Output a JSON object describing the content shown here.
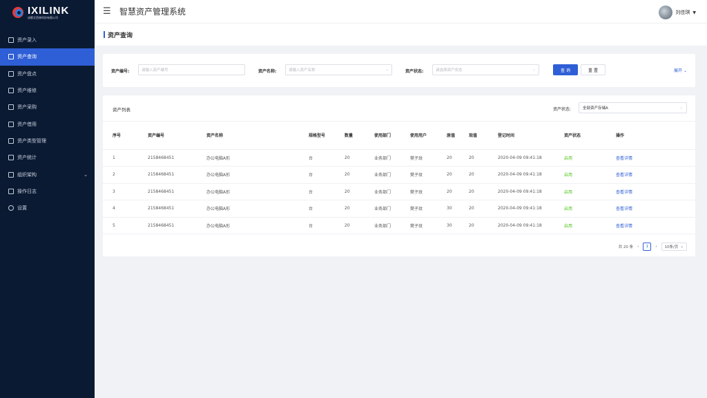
{
  "logo": {
    "name": "IXILINK",
    "subtitle": "成都艾西林科技有限公司"
  },
  "header": {
    "title": "智慧资产管理系统",
    "user_name": "刘佳琪",
    "menu_icon": "hamburger-icon"
  },
  "sidebar": {
    "items": [
      {
        "label": "资产录入",
        "icon": "edit-icon",
        "active": false
      },
      {
        "label": "资产查询",
        "icon": "search-doc-icon",
        "active": true
      },
      {
        "label": "资产盘点",
        "icon": "clipboard-icon",
        "active": false
      },
      {
        "label": "资产维修",
        "icon": "wrench-icon",
        "active": false
      },
      {
        "label": "资产采购",
        "icon": "cart-icon",
        "active": false
      },
      {
        "label": "资产借用",
        "icon": "borrow-icon",
        "active": false
      },
      {
        "label": "资产类型管理",
        "icon": "category-icon",
        "active": false
      },
      {
        "label": "资产统计",
        "icon": "chart-icon",
        "active": false
      },
      {
        "label": "组织架构",
        "icon": "org-icon",
        "active": false,
        "expandable": true
      },
      {
        "label": "操作日志",
        "icon": "log-icon",
        "active": false
      },
      {
        "label": "设置",
        "icon": "gear-icon",
        "active": false
      }
    ]
  },
  "page": {
    "title": "资产查询"
  },
  "search": {
    "asset_no_label": "资产编号:",
    "asset_no_placeholder": "请输入资产编号",
    "asset_name_label": "资产名称:",
    "asset_name_placeholder": "请输入资产名称",
    "asset_status_label": "资产状态:",
    "asset_status_placeholder": "请选择资产状态",
    "query_button": "查 询",
    "reset_button": "重 置",
    "expand_label": "展开"
  },
  "list": {
    "title": "资产列表",
    "filter_label": "资产状态:",
    "filter_value": "全部资产存储A",
    "columns": [
      "序号",
      "资产编号",
      "资产名称",
      "规格型号",
      "数量",
      "使用部门",
      "使用用户",
      "原值",
      "现值",
      "登记时间",
      "资产状态",
      "操作"
    ],
    "rows": [
      [
        "1",
        "2158468451",
        "办公电脑A形",
        "台",
        "20",
        "业务部门",
        "樊子玟",
        "20",
        "20",
        "2020-04-09 09:41:18",
        "启用",
        "查看详情"
      ],
      [
        "2",
        "2158468451",
        "办公电脑A形",
        "台",
        "20",
        "业务部门",
        "樊子玟",
        "20",
        "20",
        "2020-04-09 09:41:18",
        "启用",
        "查看详情"
      ],
      [
        "3",
        "2158468451",
        "办公电脑A形",
        "台",
        "20",
        "业务部门",
        "樊子玟",
        "20",
        "20",
        "2020-04-09 09:41:18",
        "启用",
        "查看详情"
      ],
      [
        "4",
        "2158468451",
        "办公电脑A形",
        "台",
        "20",
        "业务部门",
        "樊子玟",
        "30",
        "20",
        "2020-04-09 09:41:18",
        "启用",
        "查看详情"
      ],
      [
        "5",
        "2158468451",
        "办公电脑A形",
        "台",
        "20",
        "业务部门",
        "樊子玟",
        "30",
        "20",
        "2020-04-09 09:41:18",
        "启用",
        "查看详情"
      ]
    ],
    "pager": {
      "total": "共 20 条",
      "current_page": "1",
      "page_size": "10条/页"
    }
  },
  "colors": {
    "primary": "#2f5fd6",
    "sidebar_bg": "#0b1a33",
    "status_green": "#52c41a"
  }
}
